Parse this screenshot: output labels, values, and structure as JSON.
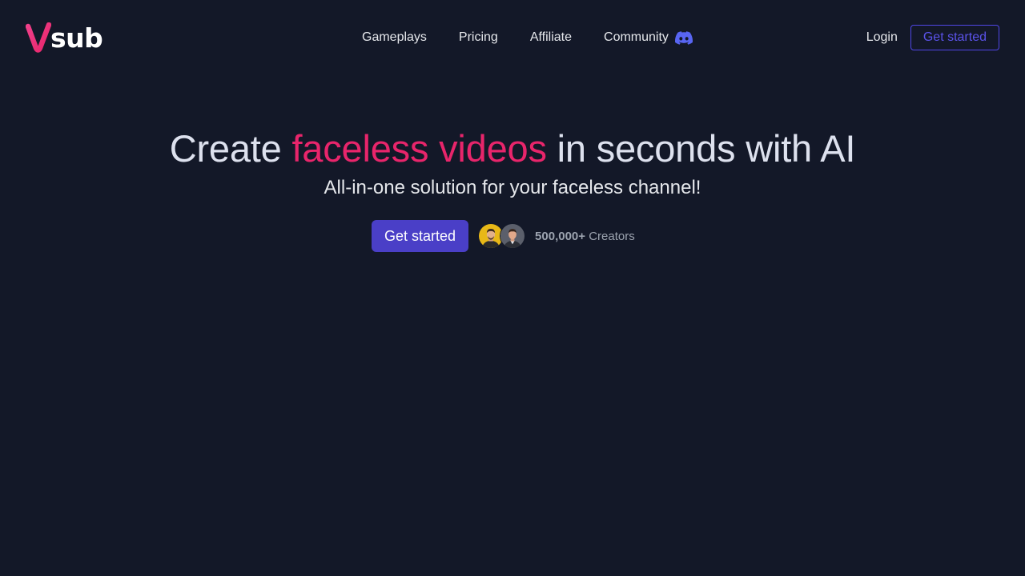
{
  "header": {
    "logo_text": "sub",
    "nav": [
      {
        "label": "Gameplays"
      },
      {
        "label": "Pricing"
      },
      {
        "label": "Affiliate"
      },
      {
        "label": "Community",
        "icon": "discord-icon"
      }
    ],
    "login_label": "Login",
    "get_started_label": "Get started"
  },
  "hero": {
    "title_before": "Create ",
    "title_accent": "faceless videos",
    "title_after": " in seconds with AI",
    "subtitle": "All-in-one solution for your faceless channel!",
    "cta_label": "Get started",
    "creators_count": "500,000+",
    "creators_label": "Creators"
  },
  "colors": {
    "background": "#131828",
    "accent_pink": "#e8256b",
    "logo_pink": "#f0408a",
    "primary_button": "#4a3fc7",
    "outline_button": "#4f46e5",
    "discord": "#5865f2"
  }
}
